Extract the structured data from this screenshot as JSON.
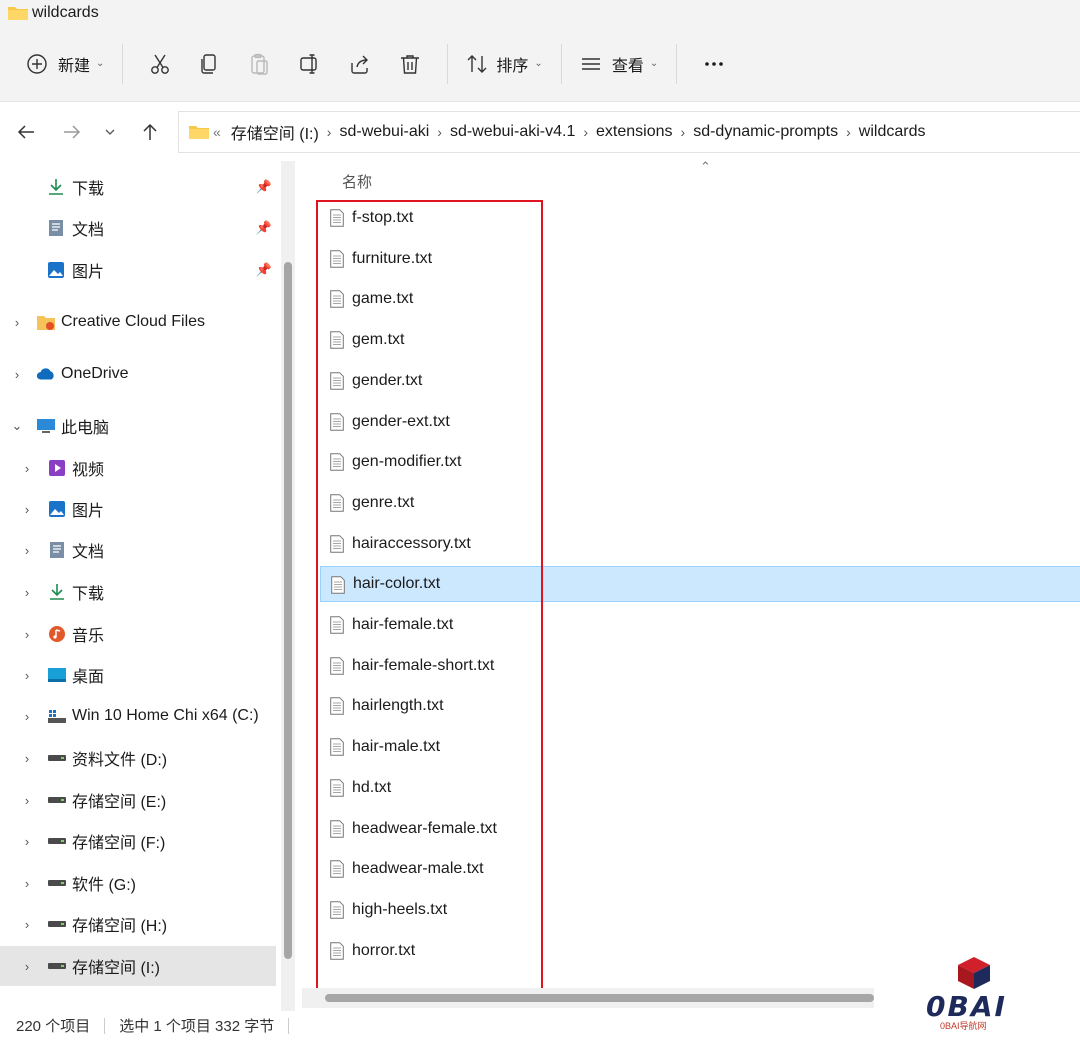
{
  "window": {
    "title": "wildcards"
  },
  "toolbar": {
    "new_label": "新建",
    "sort_label": "排序",
    "view_label": "查看",
    "icons": [
      "cut-icon",
      "copy-icon",
      "paste-icon",
      "rename-icon",
      "share-icon",
      "delete-icon"
    ]
  },
  "address": {
    "overflow": "«",
    "crumbs": [
      "存储空间 (I:)",
      "sd-webui-aki",
      "sd-webui-aki-v4.1",
      "extensions",
      "sd-dynamic-prompts",
      "wildcards"
    ]
  },
  "sidebar": {
    "quick_access": [
      {
        "label": "下载",
        "icon": "download-icon",
        "pinned": true
      },
      {
        "label": "文档",
        "icon": "document-icon",
        "pinned": true
      },
      {
        "label": "图片",
        "icon": "pictures-icon",
        "pinned": true
      }
    ],
    "roots": [
      {
        "label": "Creative Cloud Files",
        "icon": "creative-cloud-folder-icon"
      },
      {
        "label": "OneDrive",
        "icon": "onedrive-cloud-icon"
      },
      {
        "label": "此电脑",
        "icon": "this-pc-icon"
      }
    ],
    "this_pc_items": [
      {
        "label": "视频",
        "icon": "videos-icon"
      },
      {
        "label": "图片",
        "icon": "pictures-icon"
      },
      {
        "label": "文档",
        "icon": "document-icon"
      },
      {
        "label": "下载",
        "icon": "download-icon"
      },
      {
        "label": "音乐",
        "icon": "music-icon"
      },
      {
        "label": "桌面",
        "icon": "desktop-icon"
      },
      {
        "label": "Win 10 Home Chi x64 (C:)",
        "icon": "windows-drive-icon"
      },
      {
        "label": "资料文件 (D:)",
        "icon": "drive-icon"
      },
      {
        "label": "存储空间 (E:)",
        "icon": "drive-icon"
      },
      {
        "label": "存储空间 (F:)",
        "icon": "drive-icon"
      },
      {
        "label": "软件 (G:)",
        "icon": "drive-icon"
      },
      {
        "label": "存储空间 (H:)",
        "icon": "drive-icon"
      },
      {
        "label": "存储空间 (I:)",
        "icon": "drive-icon",
        "selected": true
      }
    ]
  },
  "filelist": {
    "column_name": "名称",
    "files": [
      "f-stop.txt",
      "furniture.txt",
      "game.txt",
      "gem.txt",
      "gender.txt",
      "gender-ext.txt",
      "gen-modifier.txt",
      "genre.txt",
      "hairaccessory.txt",
      "hair-color.txt",
      "hair-female.txt",
      "hair-female-short.txt",
      "hairlength.txt",
      "hair-male.txt",
      "hd.txt",
      "headwear-female.txt",
      "headwear-male.txt",
      "high-heels.txt",
      "horror.txt"
    ],
    "selected_file": "hair-color.txt"
  },
  "status": {
    "item_count": "220 个项目",
    "selection": "选中 1 个项目 332 字节"
  },
  "watermark": {
    "text": "0BAI",
    "sub": "0BAI导航网"
  },
  "colors": {
    "selection_bg": "#cce8ff",
    "highlight_box": "#e0141e",
    "folder_yellow": "#f7c948"
  }
}
